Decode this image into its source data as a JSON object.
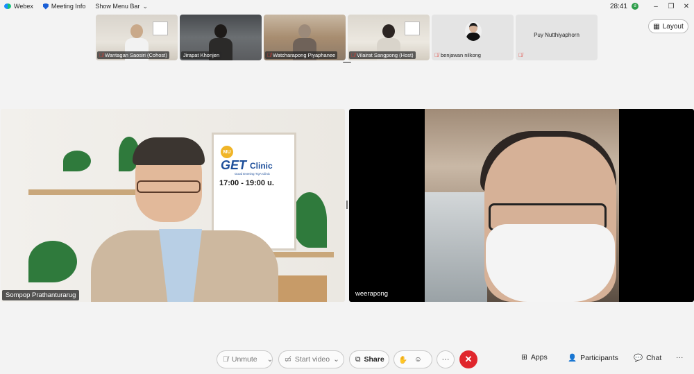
{
  "topbar": {
    "app_name": "Webex",
    "meeting_info": "Meeting Info",
    "show_menu_bar": "Show Menu Bar",
    "clock": "28:41",
    "status_badge": "d"
  },
  "thumbnails": [
    {
      "name": "Wantagan Saosiri (Cohost)",
      "muted": true
    },
    {
      "name": "Jirapat Khonjen",
      "muted": false
    },
    {
      "name": "Watcharapong Piyaphanee",
      "muted": true
    },
    {
      "name": "Vilairat Sangpong (Host)",
      "muted": true
    },
    {
      "name": "benjawan nilkong",
      "muted": true
    },
    {
      "name": "Puy Nutthiyaphorn",
      "muted": true
    }
  ],
  "layout_button": "Layout",
  "main_videos": {
    "left": {
      "name": "Sompop Prathanturarug",
      "poster": {
        "logo": "MU",
        "brand": "GET",
        "clinic": "Clinic",
        "subtitle": "Good Evening TQA Clinic",
        "time": "17:00 - 19:00 u."
      }
    },
    "right": {
      "name": "weerapong"
    }
  },
  "controls": {
    "unmute": "Unmute",
    "start_video": "Start video",
    "share": "Share",
    "more": "···",
    "apps": "Apps",
    "participants": "Participants",
    "chat": "Chat",
    "overflow": "···"
  },
  "colors": {
    "end_call": "#e0262c",
    "mic_muted": "#e0443c",
    "brand_blue": "#1d4e9a"
  }
}
